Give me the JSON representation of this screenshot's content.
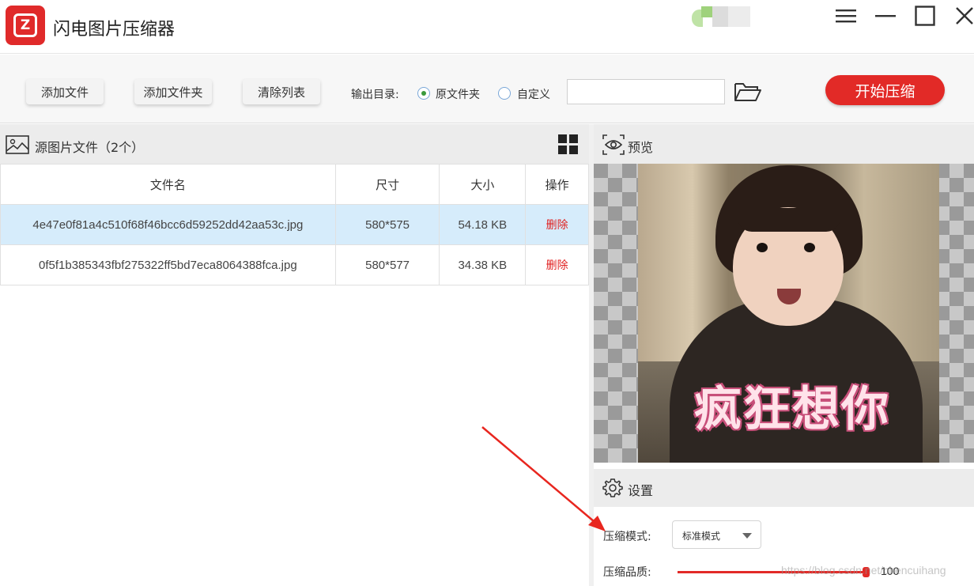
{
  "app": {
    "title": "闪电图片压缩器",
    "logo_letter": "Z"
  },
  "window_controls": {
    "menu": "menu-icon",
    "minimize": "minimize-icon",
    "maximize": "maximize-icon",
    "close": "close-icon"
  },
  "toolbar": {
    "add_file": "添加文件",
    "add_folder": "添加文件夹",
    "clear_list": "清除列表",
    "output_label": "输出目录:",
    "radio_original": "原文件夹",
    "radio_custom": "自定义",
    "selected_output": "原文件夹",
    "path_value": "",
    "start": "开始压缩"
  },
  "source_panel": {
    "title": "源图片文件（2个）",
    "columns": [
      "文件名",
      "尺寸",
      "大小",
      "操作"
    ],
    "rows": [
      {
        "name": "4e47e0f81a4c510f68f46bcc6d59252dd42aa53c.jpg",
        "size": "580*575",
        "filesize": "54.18 KB",
        "action": "删除",
        "selected": true
      },
      {
        "name": "0f5f1b385343fbf275322ff5bd7eca8064388fca.jpg",
        "size": "580*577",
        "filesize": "34.38 KB",
        "action": "删除",
        "selected": false
      }
    ]
  },
  "preview_panel": {
    "title": "预览",
    "caption": "疯狂想你"
  },
  "settings": {
    "title": "设置",
    "mode_label": "压缩模式:",
    "mode_value": "标准模式",
    "quality_label": "压缩品质:",
    "quality_value": "100"
  },
  "watermark": "https://blog.csdn.net/chencuihang",
  "colors": {
    "accent": "#e22a27",
    "selected_row": "#d6ecfb",
    "delete_text": "#e02020"
  }
}
